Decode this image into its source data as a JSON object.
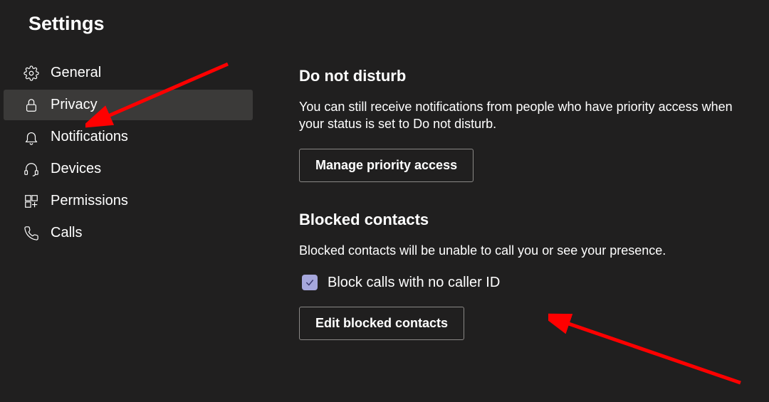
{
  "page_title": "Settings",
  "sidebar": {
    "items": [
      {
        "icon": "gear-icon",
        "label": "General",
        "active": false
      },
      {
        "icon": "lock-icon",
        "label": "Privacy",
        "active": true
      },
      {
        "icon": "bell-icon",
        "label": "Notifications",
        "active": false
      },
      {
        "icon": "headset-icon",
        "label": "Devices",
        "active": false
      },
      {
        "icon": "apps-icon",
        "label": "Permissions",
        "active": false
      },
      {
        "icon": "phone-icon",
        "label": "Calls",
        "active": false
      }
    ]
  },
  "main": {
    "dnd": {
      "title": "Do not disturb",
      "description": "You can still receive notifications from people who have priority access when your status is set to Do not disturb.",
      "button": "Manage priority access"
    },
    "blocked": {
      "title": "Blocked contacts",
      "description": "Blocked contacts will be unable to call you or see your presence.",
      "checkbox_label": "Block calls with no caller ID",
      "checkbox_checked": true,
      "button": "Edit blocked contacts"
    }
  },
  "annotation": {
    "arrow_color": "#ff0000"
  }
}
